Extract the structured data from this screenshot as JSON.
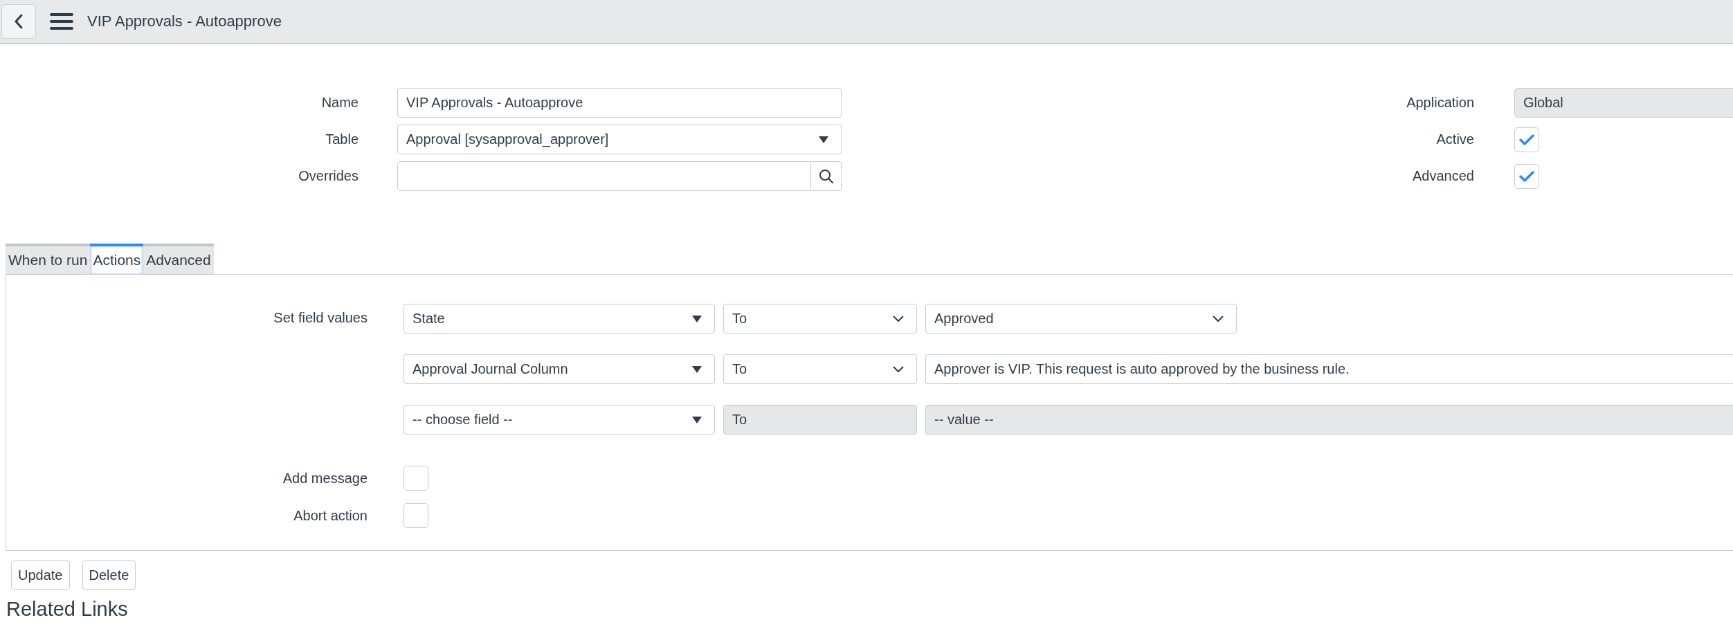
{
  "header": {
    "title": "VIP Approvals - Autoapprove"
  },
  "left_fields": [
    {
      "label": "Name",
      "kind": "text",
      "value": "VIP Approvals - Autoapprove"
    },
    {
      "label": "Table",
      "kind": "select",
      "value": "Approval [sysapproval_approver]"
    },
    {
      "label": "Overrides",
      "kind": "reference"
    }
  ],
  "right_fields": [
    {
      "label": "Application",
      "kind": "readonly",
      "value": "Global"
    },
    {
      "label": "Active",
      "kind": "checkbox",
      "checked": true
    },
    {
      "label": "Advanced",
      "kind": "checkbox",
      "checked": true
    }
  ],
  "tabs": [
    {
      "label": "When to run",
      "selected": false
    },
    {
      "label": "Actions",
      "selected": true
    },
    {
      "label": "Advanced",
      "selected": false
    }
  ],
  "actions": {
    "label": "Set field values",
    "rows": [
      {
        "field": "State",
        "operator": "To",
        "value": "Approved",
        "kind": "select",
        "disabled": false
      },
      {
        "field": "Approval Journal Column",
        "operator": "To",
        "value": "Approver is VIP. This request is auto approved by the business rule.",
        "kind": "text",
        "disabled": false
      },
      {
        "field": "-- choose field --",
        "operator": "To",
        "value": "-- value --",
        "kind": "text",
        "disabled": true
      }
    ]
  },
  "options": [
    {
      "label": "Add message",
      "checked": false
    },
    {
      "label": "Abort action",
      "checked": false
    }
  ],
  "buttons": [
    "Update",
    "Delete"
  ],
  "related_links": "Related Links"
}
